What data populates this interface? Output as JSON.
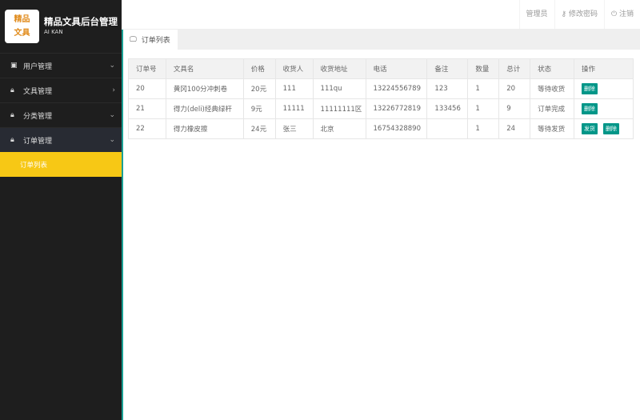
{
  "app": {
    "logo_text": [
      "精品",
      "文具"
    ],
    "title": "精品文具后台管理",
    "subtitle": "AI KAN"
  },
  "sidebar": {
    "items": [
      {
        "label": "用户管理",
        "icon": "id-card-icon",
        "chevron": "⌄"
      },
      {
        "label": "文具管理",
        "icon": "lock-icon",
        "chevron": "›"
      },
      {
        "label": "分类管理",
        "icon": "lock-icon",
        "chevron": "⌄"
      },
      {
        "label": "订单管理",
        "icon": "lock-icon",
        "chevron": "⌄"
      }
    ],
    "sub_item": "订单列表"
  },
  "header": {
    "user": "管理员",
    "change_password": "修改密码",
    "logout": "注销"
  },
  "tab": {
    "label": "订单列表"
  },
  "table": {
    "headers": [
      "订单号",
      "文具名",
      "价格",
      "收货人",
      "收货地址",
      "电话",
      "备注",
      "数量",
      "总计",
      "状态",
      "操作"
    ],
    "rows": [
      {
        "cells": [
          "20",
          "黄冈100分冲刺卷",
          "20元",
          "111",
          "111qu",
          "13224556789",
          "123",
          "1",
          "20",
          "等待收货"
        ],
        "actions": [
          "删除"
        ]
      },
      {
        "cells": [
          "21",
          "得力(deli)经典绿杆",
          "9元",
          "11111",
          "11111111区",
          "13226772819",
          "133456",
          "1",
          "9",
          "订单完成"
        ],
        "actions": [
          "删除"
        ]
      },
      {
        "cells": [
          "22",
          "得力橡皮擦",
          "24元",
          "张三",
          "北京",
          "16754328890",
          "",
          "1",
          "24",
          "等待发货"
        ],
        "actions": [
          "发货",
          "删除"
        ]
      }
    ]
  },
  "colors": {
    "accent": "#009688",
    "highlight": "#f7c815",
    "sidebar": "#1e1e1e"
  }
}
